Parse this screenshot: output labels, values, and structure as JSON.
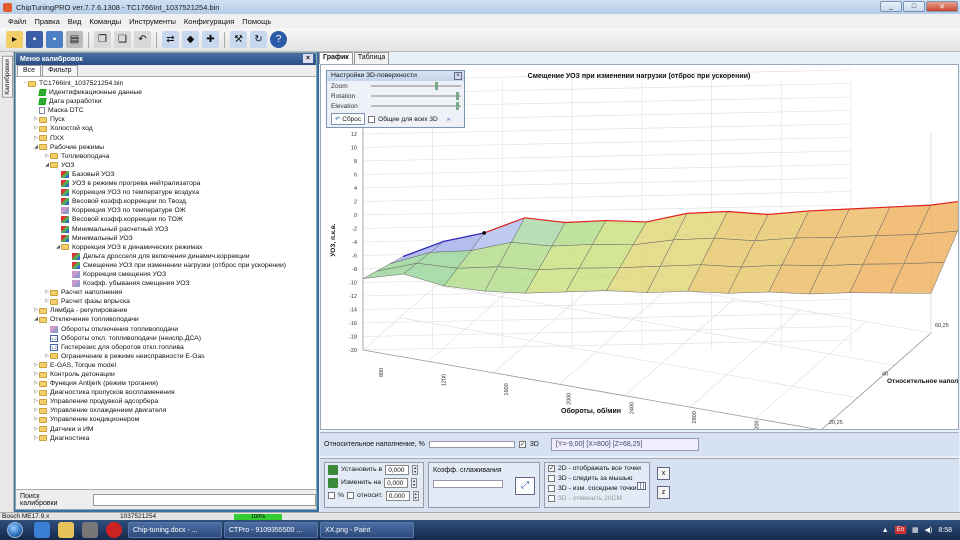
{
  "window": {
    "title": "ChipTuningPRO ver.7.7.6.1308 - TC1766Int_1037521254.bin",
    "min": "_",
    "max": "□",
    "close": "✕"
  },
  "menu": [
    "Файл",
    "Правка",
    "Вид",
    "Команды",
    "Инструменты",
    "Конфигурация",
    "Помощь"
  ],
  "side_strip_label": "Калибровки",
  "calib": {
    "title": "Меню калибровок",
    "tabs": [
      "Все",
      "Фильтр"
    ],
    "search_label": "Поиск калибровки",
    "tree": [
      {
        "d": 0,
        "t": "TC1766Int_1037521254.bin",
        "i": "folder",
        "e": "−"
      },
      {
        "d": 1,
        "t": "Идентификационные данные",
        "i": "check",
        "e": ""
      },
      {
        "d": 1,
        "t": "Дата разработки",
        "i": "check",
        "e": ""
      },
      {
        "d": 1,
        "t": "Маска DTC",
        "i": "doc",
        "e": ""
      },
      {
        "d": 1,
        "t": "Пуск",
        "i": "folder",
        "e": "▷"
      },
      {
        "d": 1,
        "t": "Холостой ход",
        "i": "folder",
        "e": "▷"
      },
      {
        "d": 1,
        "t": "ПХХ",
        "i": "folder",
        "e": "▷"
      },
      {
        "d": 1,
        "t": "Рабочие режимы",
        "i": "folder",
        "e": "◢"
      },
      {
        "d": 2,
        "t": "Топливоподача",
        "i": "folder",
        "e": "▷"
      },
      {
        "d": 2,
        "t": "УОЗ",
        "i": "folder",
        "e": "◢"
      },
      {
        "d": 3,
        "t": "Базовый УОЗ",
        "i": "map",
        "e": ""
      },
      {
        "d": 3,
        "t": "УОЗ в режиме прогрева нейтрализатора",
        "i": "map",
        "e": ""
      },
      {
        "d": 3,
        "t": "Коррекция УОЗ по температуре воздуха",
        "i": "map",
        "e": ""
      },
      {
        "d": 3,
        "t": "Весовой коэфф.коррекции по Твозд.",
        "i": "map",
        "e": ""
      },
      {
        "d": 3,
        "t": "Коррекция УОЗ по температуре ОЖ",
        "i": "chart",
        "e": ""
      },
      {
        "d": 3,
        "t": "Весовой коэфф.коррекции по ТОЖ",
        "i": "map",
        "e": ""
      },
      {
        "d": 3,
        "t": "Минимальный расчетный УОЗ",
        "i": "map",
        "e": ""
      },
      {
        "d": 3,
        "t": "Минимальный УОЗ",
        "i": "map",
        "e": ""
      },
      {
        "d": 3,
        "t": "Коррекция УОЗ в динамических режимах",
        "i": "folder",
        "e": "◢"
      },
      {
        "d": 4,
        "t": "Дельта дросселя для включения динамич.коррекции",
        "i": "map",
        "e": ""
      },
      {
        "d": 4,
        "t": "Смещение УОЗ при изменении нагрузки (отброс при ускорении)",
        "i": "map",
        "e": ""
      },
      {
        "d": 4,
        "t": "Коррекция смещения УОЗ",
        "i": "chart",
        "e": ""
      },
      {
        "d": 4,
        "t": "Коэфф. убывания смещения УОЗ",
        "i": "chart",
        "e": ""
      },
      {
        "d": 2,
        "t": "Расчет наполнения",
        "i": "folder",
        "e": "▷"
      },
      {
        "d": 2,
        "t": "Расчет фазы впрыска",
        "i": "folder",
        "e": "▷"
      },
      {
        "d": 1,
        "t": "Лямбда - регулирование",
        "i": "folder",
        "e": "▷"
      },
      {
        "d": 1,
        "t": "Отключение топливоподачи",
        "i": "folder",
        "e": "◢"
      },
      {
        "d": 2,
        "t": "Обороты отключения топливоподачи",
        "i": "chart",
        "e": ""
      },
      {
        "d": 2,
        "t": "Обороты откл. топливоподачи (неиспр.ДСА)",
        "i": "num",
        "e": ""
      },
      {
        "d": 2,
        "t": "Гистерезис для оборотов откл.топлива",
        "i": "num",
        "e": ""
      },
      {
        "d": 2,
        "t": "Ограничение в режиме неисправности E-Gas",
        "i": "folder",
        "e": "▷"
      },
      {
        "d": 1,
        "t": "E-GAS, Torque model",
        "i": "folder",
        "e": "▷"
      },
      {
        "d": 1,
        "t": "Контроль детонации",
        "i": "folder",
        "e": "▷"
      },
      {
        "d": 1,
        "t": "Функция Antijerk (режим трогания)",
        "i": "folder",
        "e": "▷"
      },
      {
        "d": 1,
        "t": "Диагностика пропусков воспламенения",
        "i": "folder",
        "e": "▷"
      },
      {
        "d": 1,
        "t": "Управление продувкой адсорбера",
        "i": "folder",
        "e": "▷"
      },
      {
        "d": 1,
        "t": "Управление охлаждением двигателя",
        "i": "folder",
        "e": "▷"
      },
      {
        "d": 1,
        "t": "Управление кондиционером",
        "i": "folder",
        "e": "▷"
      },
      {
        "d": 1,
        "t": "Датчики и ИМ",
        "i": "folder",
        "e": "▷"
      },
      {
        "d": 1,
        "t": "Диагностика",
        "i": "folder",
        "e": "▷"
      }
    ]
  },
  "graph_tabs": [
    "График",
    "Таблица"
  ],
  "settings3d": {
    "title": "Настройки 3D-поверхности",
    "sliders": [
      {
        "name": "Zoom",
        "pos": 0.74
      },
      {
        "name": "Rotation",
        "pos": 0.98
      },
      {
        "name": "Elevation",
        "pos": 0.98
      }
    ],
    "reset": "Сброс",
    "common": "Общие для всех 3D"
  },
  "chart_data": {
    "type": "surface3d",
    "title": "Смещение УОЗ при изменении нагрузки (отброс при ускорении)",
    "zlabel": "УОЗ, п.к.в.",
    "xlabel": "Обороты, об/мин",
    "ylabel": "Относительное напол",
    "z_ticks": [
      20,
      18,
      16,
      14,
      12,
      10,
      8,
      6,
      4,
      2,
      0,
      -2,
      -4,
      -6,
      -8,
      -10,
      -12,
      -14,
      -16,
      -18,
      -20
    ],
    "zlim": [
      -20,
      20
    ],
    "x_ticks": [
      800,
      1200,
      1600,
      2000,
      2400,
      2800,
      3200,
      3600
    ],
    "y_ticks": [
      "20,25",
      "40",
      "60,25"
    ],
    "front_edge": [
      -2,
      0,
      -3,
      -4,
      -4,
      -3,
      -2,
      -2,
      -1,
      -1,
      0,
      0,
      1,
      1.5,
      2
    ],
    "back_edge": [
      -2,
      2,
      4,
      8,
      6,
      6,
      5,
      7,
      7,
      5.5,
      6,
      6,
      6,
      6,
      7
    ],
    "marked_point": {
      "x": 1200,
      "z": 8
    }
  },
  "rbar": {
    "label": "Относительное наполнение, %",
    "chk3d": "3D",
    "readout": "[Y=-9,00] [X=800] [Z=68,25]"
  },
  "controls": {
    "set_label": "Установить в",
    "set_val": "0,000",
    "change_label": "Изменить на",
    "change_val": "0,000",
    "percent": "%",
    "relative": "относит.",
    "rel_val": "0,000",
    "smooth_label": "Коэфф. сглаживания",
    "options": [
      "2D - отображать все точки",
      "3D - следить за мышью",
      "3D - изм. соседние точки",
      "3D - отменить 20СМ"
    ],
    "btn_x": "x",
    "btn_z": "z"
  },
  "statusbar": {
    "ecu": "Bosch ME17.9.x",
    "id": "1037521254",
    "progress": "100%"
  },
  "taskbar": {
    "tasks": [
      "Chip-tuning.docx - ...",
      "CTPro - 9109355500 ...",
      "XX.png - Paint"
    ],
    "lang": "En",
    "time": "8:58"
  }
}
